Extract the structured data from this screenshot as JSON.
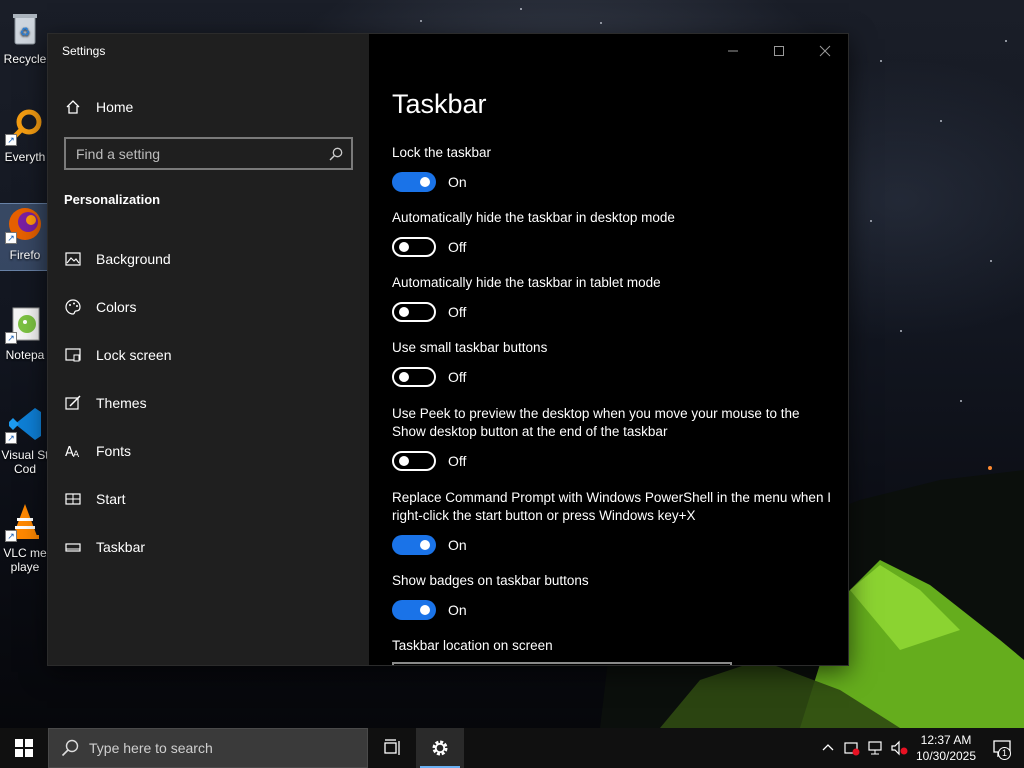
{
  "desktop": {
    "icons": [
      {
        "label": "Recycle",
        "icon": "recycle-bin-icon"
      },
      {
        "label": "Everyth",
        "icon": "everything-search-icon"
      },
      {
        "label": "Firefo",
        "icon": "firefox-icon"
      },
      {
        "label": "Notepa",
        "icon": "notepad-plus-plus-icon"
      },
      {
        "label": "Visual St",
        "label2": "Cod",
        "icon": "vscode-icon"
      },
      {
        "label": "VLC me",
        "label2": "playe",
        "icon": "vlc-icon"
      }
    ]
  },
  "window": {
    "title": "Settings",
    "controls": {
      "minimize": "—",
      "maximize": "☐",
      "close": "✕"
    }
  },
  "nav": {
    "home_label": "Home",
    "search_placeholder": "Find a setting",
    "section": "Personalization",
    "items": [
      {
        "label": "Background",
        "icon": "picture-icon"
      },
      {
        "label": "Colors",
        "icon": "palette-icon"
      },
      {
        "label": "Lock screen",
        "icon": "lock-screen-icon"
      },
      {
        "label": "Themes",
        "icon": "brush-icon"
      },
      {
        "label": "Fonts",
        "icon": "fonts-icon"
      },
      {
        "label": "Start",
        "icon": "start-tiles-icon"
      },
      {
        "label": "Taskbar",
        "icon": "taskbar-icon",
        "selected": true
      }
    ]
  },
  "page": {
    "title": "Taskbar",
    "settings": [
      {
        "label": "Lock the taskbar",
        "state": "On",
        "on": true
      },
      {
        "label": "Automatically hide the taskbar in desktop mode",
        "state": "Off",
        "on": false
      },
      {
        "label": "Automatically hide the taskbar in tablet mode",
        "state": "Off",
        "on": false
      },
      {
        "label": "Use small taskbar buttons",
        "state": "Off",
        "on": false
      },
      {
        "label": "Use Peek to preview the desktop when you move your mouse to the Show desktop button at the end of the taskbar",
        "state": "Off",
        "on": false
      },
      {
        "label": "Replace Command Prompt with Windows PowerShell in the menu when I right-click the start button or press Windows key+X",
        "state": "On",
        "on": true
      },
      {
        "label": "Show badges on taskbar buttons",
        "state": "On",
        "on": true
      }
    ],
    "location_label": "Taskbar location on screen"
  },
  "taskbar": {
    "search_text": "Type here to search",
    "clock_time": "12:37 AM",
    "clock_date": "10/30/2025",
    "notification_count": "1"
  },
  "colors": {
    "accent": "#1a73e8",
    "nav_bg": "#1f1f1f",
    "content_bg": "#000000"
  }
}
